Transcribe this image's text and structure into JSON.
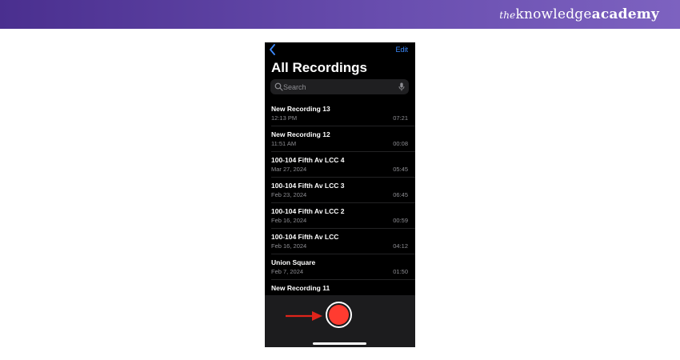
{
  "banner": {
    "brand_the": "the",
    "brand_knowledge": "knowledge",
    "brand_academy": "academy",
    "color": "#5b3fa0"
  },
  "app": {
    "edit_label": "Edit",
    "back_icon": "chevron-left-icon",
    "title": "All Recordings",
    "search_placeholder": "Search",
    "accent_color": "#3d8bff",
    "record_color": "#ff3b30"
  },
  "recordings": [
    {
      "name": "New Recording 13",
      "date": "12:13 PM",
      "duration": "07:21"
    },
    {
      "name": "New Recording 12",
      "date": "11:51 AM",
      "duration": "00:08"
    },
    {
      "name": "100-104 Fifth Av LCC 4",
      "date": "Mar 27, 2024",
      "duration": "05:45"
    },
    {
      "name": "100-104 Fifth Av LCC 3",
      "date": "Feb 23, 2024",
      "duration": "06:45"
    },
    {
      "name": "100-104 Fifth Av LCC 2",
      "date": "Feb 16, 2024",
      "duration": "00:59"
    },
    {
      "name": "100-104 Fifth Av LCC",
      "date": "Feb 16, 2024",
      "duration": "04:12"
    },
    {
      "name": "Union Square",
      "date": "Feb 7, 2024",
      "duration": "01:50"
    },
    {
      "name": "New Recording 11",
      "date": "",
      "duration": ""
    }
  ]
}
